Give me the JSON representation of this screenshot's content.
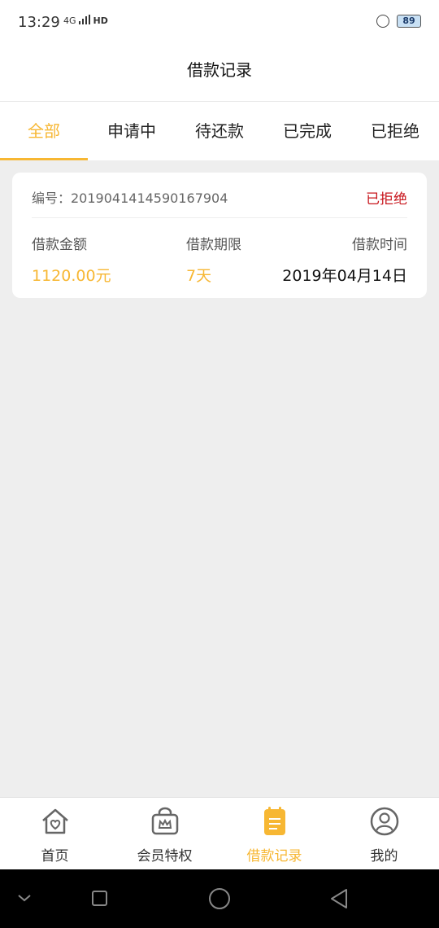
{
  "status_bar": {
    "time": "13:29",
    "network": "4G",
    "hd": "HD",
    "battery": "89"
  },
  "header": {
    "title": "借款记录"
  },
  "tabs": [
    {
      "label": "全部",
      "active": true
    },
    {
      "label": "申请中",
      "active": false
    },
    {
      "label": "待还款",
      "active": false
    },
    {
      "label": "已完成",
      "active": false
    },
    {
      "label": "已拒绝",
      "active": false
    }
  ],
  "record": {
    "order_label": "编号：2019041414590167904",
    "status": "已拒绝",
    "amount_label": "借款金额",
    "amount_value": "1120.00元",
    "term_label": "借款期限",
    "term_value": "7天",
    "time_label": "借款时间",
    "time_value": "2019年04月14日"
  },
  "bottom_nav": [
    {
      "label": "首页",
      "icon": "home-heart-icon"
    },
    {
      "label": "会员特权",
      "icon": "vip-crown-icon"
    },
    {
      "label": "借款记录",
      "icon": "record-note-icon",
      "active": true
    },
    {
      "label": "我的",
      "icon": "user-icon"
    }
  ],
  "colors": {
    "accent": "#f7b733",
    "rejected": "#c8161d"
  }
}
